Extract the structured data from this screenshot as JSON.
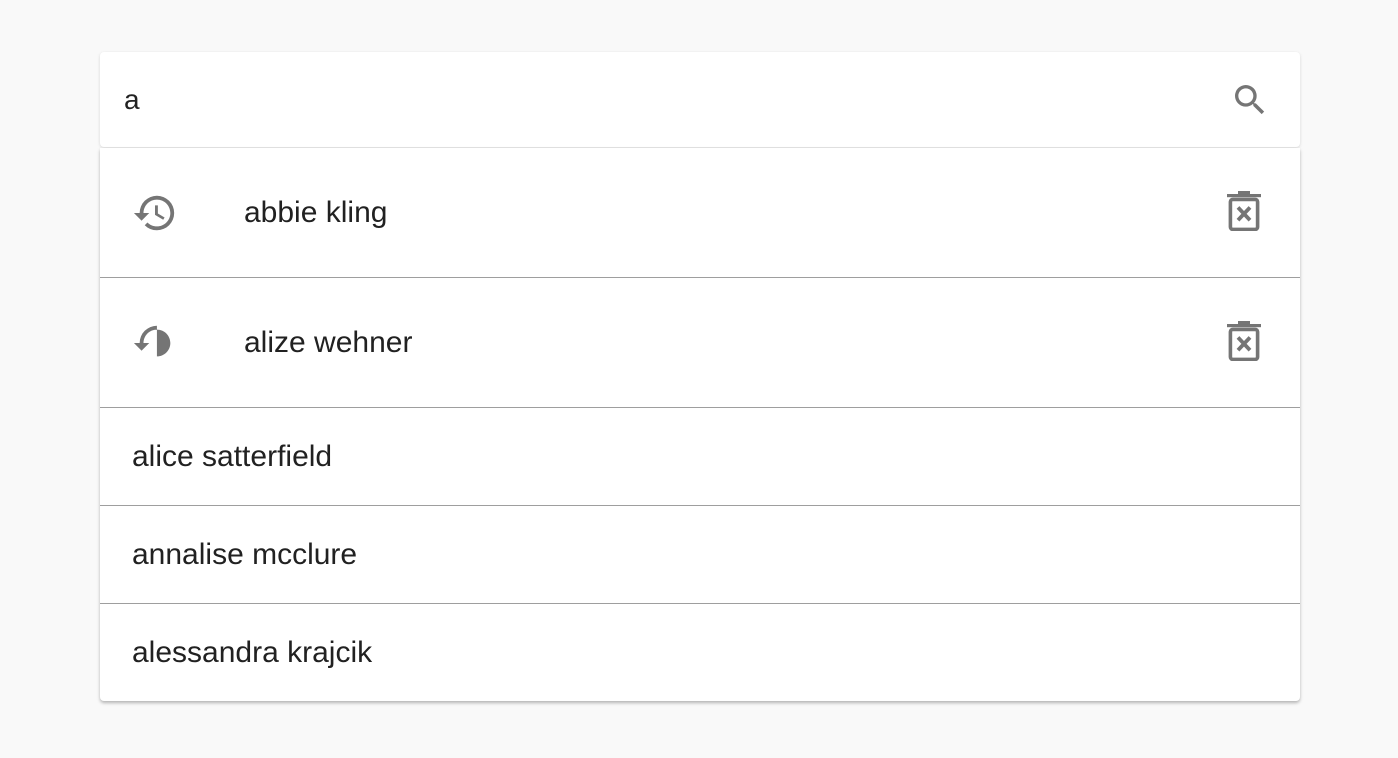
{
  "search": {
    "value": "a",
    "icon": "search-icon"
  },
  "history": [
    {
      "label": "abbie kling",
      "icon": "history-icon",
      "action_icon": "delete-icon"
    },
    {
      "label": "alize wehner",
      "icon": "history-icon",
      "action_icon": "delete-icon"
    }
  ],
  "suggestions": [
    {
      "label": "alice satterfield"
    },
    {
      "label": "annalise mcclure"
    },
    {
      "label": "alessandra krajcik"
    }
  ],
  "colors": {
    "background": "#f9f9f9",
    "surface": "#ffffff",
    "text": "#212121",
    "icon": "#757575",
    "divider": "#9e9e9e"
  }
}
